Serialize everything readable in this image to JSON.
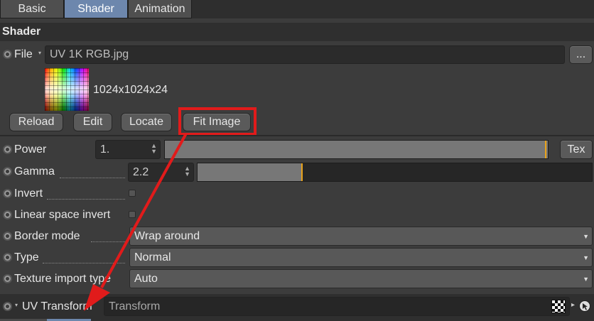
{
  "tabs": [
    {
      "label": "Basic"
    },
    {
      "label": "Shader"
    },
    {
      "label": "Animation"
    }
  ],
  "section_title": "Shader",
  "file": {
    "label": "File",
    "value": "UV 1K RGB.jpg",
    "browse_label": "..."
  },
  "image_info": "1024x1024x24",
  "buttons": {
    "reload": "Reload",
    "edit": "Edit",
    "locate": "Locate",
    "fit_image": "Fit Image"
  },
  "params": {
    "power": {
      "label": "Power",
      "value": "1.",
      "level": 1.0,
      "tex_label": "Tex"
    },
    "gamma": {
      "label": "Gamma",
      "value": "2.2",
      "level": 0.27
    },
    "invert": {
      "label": "Invert",
      "checked": false
    },
    "linear_space_invert": {
      "label": "Linear space invert",
      "checked": false
    },
    "border_mode": {
      "label": "Border mode",
      "value": "Wrap around"
    },
    "type": {
      "label": "Type",
      "value": "Normal"
    },
    "texture_import_type": {
      "label": "Texture import type",
      "value": "Auto"
    }
  },
  "uv_transform": {
    "label": "UV Transform",
    "value": "Transform"
  },
  "colors": {
    "highlight": "#e11b1b",
    "active_tab": "#6d87ad",
    "slider_marker": "#e8a21a"
  }
}
